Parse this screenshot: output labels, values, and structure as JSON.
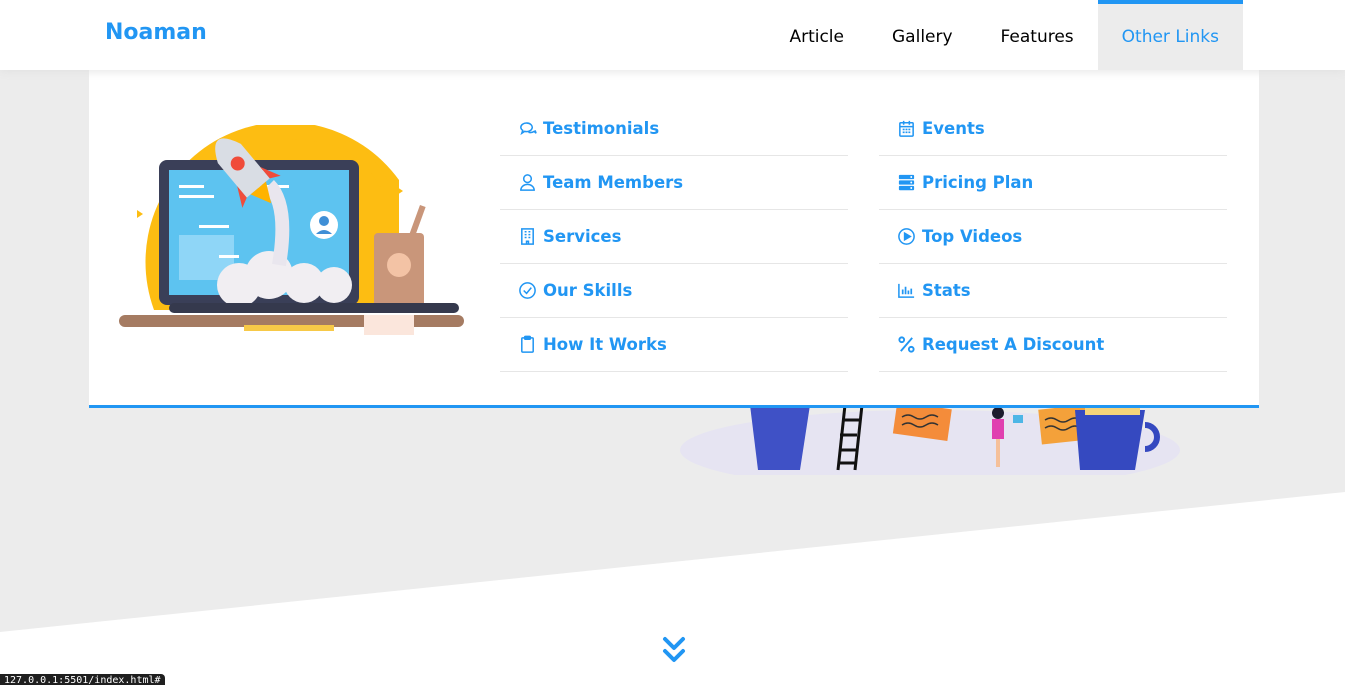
{
  "header": {
    "logo": "Noaman",
    "nav": [
      {
        "label": "Article"
      },
      {
        "label": "Gallery"
      },
      {
        "label": "Features"
      },
      {
        "label": "Other Links",
        "active": true
      }
    ]
  },
  "mega_menu": {
    "columns": [
      [
        {
          "label": "Testimonials",
          "icon": "comments-icon"
        },
        {
          "label": "Team Members",
          "icon": "user-icon"
        },
        {
          "label": "Services",
          "icon": "building-icon"
        },
        {
          "label": "Our Skills",
          "icon": "check-circle-icon"
        },
        {
          "label": "How It Works",
          "icon": "clipboard-icon"
        }
      ],
      [
        {
          "label": "Events",
          "icon": "calendar-icon"
        },
        {
          "label": "Pricing Plan",
          "icon": "server-icon"
        },
        {
          "label": "Top Videos",
          "icon": "play-circle-icon"
        },
        {
          "label": "Stats",
          "icon": "bar-chart-icon"
        },
        {
          "label": "Request A Discount",
          "icon": "percent-icon"
        }
      ]
    ]
  },
  "status_bar": {
    "url": "127.0.0.1:5501/index.html#"
  },
  "colors": {
    "accent": "#2196f3",
    "background": "#ececec"
  }
}
